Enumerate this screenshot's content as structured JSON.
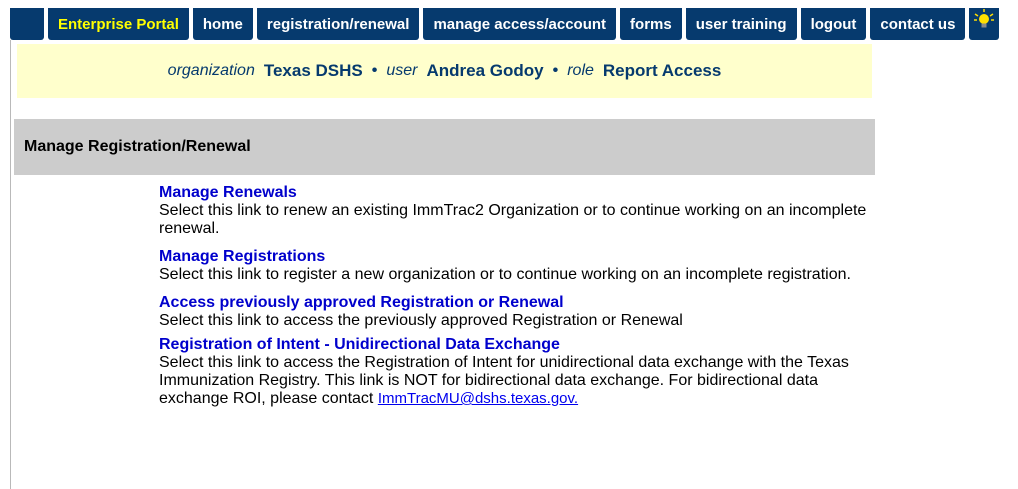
{
  "nav": {
    "brand": "Enterprise Portal",
    "items": [
      {
        "label": "home"
      },
      {
        "label": "registration/renewal"
      },
      {
        "label": "manage access/account"
      },
      {
        "label": "forms"
      },
      {
        "label": "user training"
      },
      {
        "label": "logout"
      },
      {
        "label": "contact us"
      }
    ],
    "tip_icon": "lightbulb-icon"
  },
  "context": {
    "organization_label": "organization",
    "organization_value": "Texas DSHS",
    "user_label": "user",
    "user_value": "Andrea Godoy",
    "role_label": "role",
    "role_value": "Report Access",
    "separator": "•"
  },
  "section": {
    "title": "Manage Registration/Renewal"
  },
  "links": [
    {
      "title": "Manage Renewals",
      "description": "Select this link to renew an existing ImmTrac2 Organization or to continue working on an incomplete renewal."
    },
    {
      "title": "Manage Registrations",
      "description": "Select this link to register a new organization or to continue working on an incomplete registration."
    },
    {
      "title": "Access previously approved Registration or Renewal",
      "description": "Select this link to access the previously approved Registration or Renewal"
    },
    {
      "title": "Registration of Intent - Unidirectional Data Exchange",
      "description": "Select this link to access the Registration of Intent for unidirectional data exchange with the Texas Immunization Registry. This link is NOT for bidirectional data exchange. For bidirectional data exchange ROI, please contact",
      "email": "ImmTracMU@dshs.texas.gov."
    }
  ],
  "colors": {
    "nav_bg": "#063a6e",
    "brand_text": "#ffff00",
    "info_bg": "#ffffcc",
    "header_bg": "#cccccc",
    "link": "#0000cc"
  }
}
